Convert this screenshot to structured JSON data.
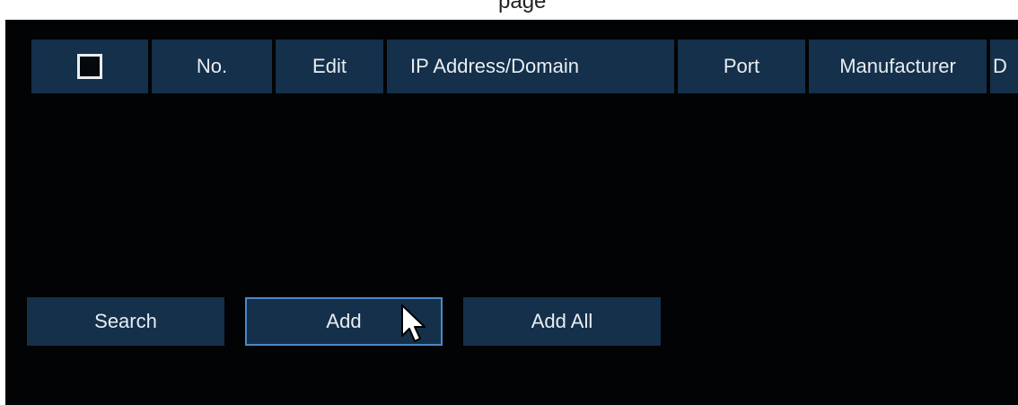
{
  "top_strip": {
    "text": "page"
  },
  "table": {
    "headers": {
      "no": "No.",
      "edit": "Edit",
      "ip": "IP Address/Domain",
      "port": "Port",
      "manufacturer": "Manufacturer",
      "device_type_cropped": "D"
    },
    "select_all_checked": false,
    "rows": []
  },
  "buttons": {
    "search": "Search",
    "add": "Add",
    "add_all": "Add All"
  },
  "colors": {
    "background": "#020304",
    "cell_bg": "#14304a",
    "focus_border": "#4a89c8",
    "text": "#e9edf2"
  },
  "icons": {
    "cursor": "mouse-pointer-icon",
    "checkbox": "checkbox-icon"
  }
}
